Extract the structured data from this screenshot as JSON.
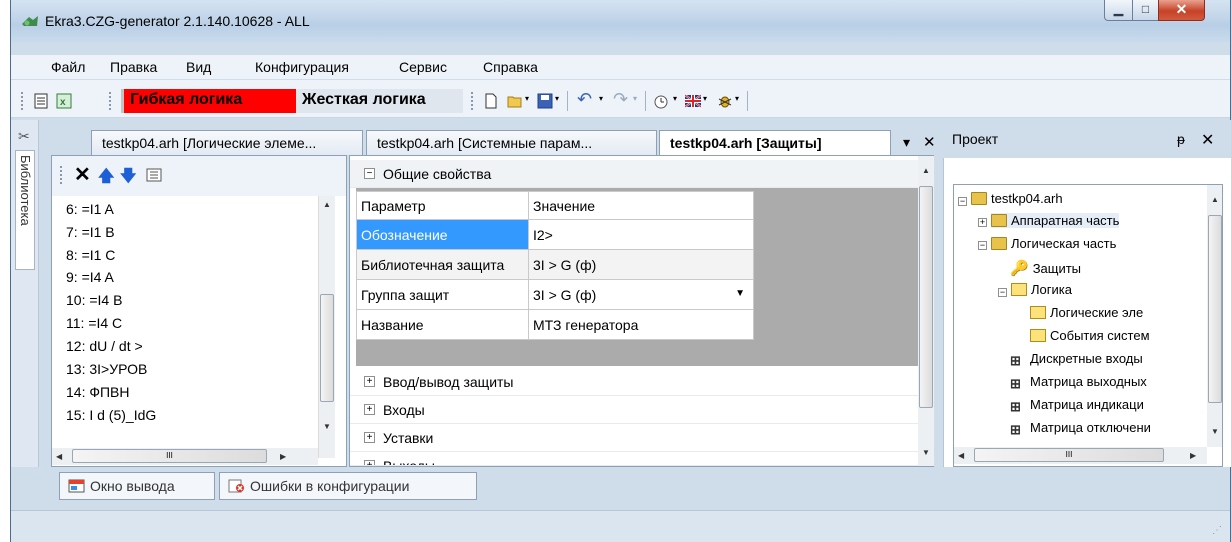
{
  "window": {
    "title": "Ekra3.CZG-generator 2.1.140.10628 - ALL",
    "minimize_glyph": "▁",
    "maximize_glyph": "□",
    "close_glyph": "✕"
  },
  "menu": [
    "Файл",
    "Правка",
    "Вид",
    "Конфигурация",
    "Сервис",
    "Справка"
  ],
  "toolbar": {
    "flex_logic_label": "Гибкая логика",
    "flex_logic_color": "#ff0000",
    "hard_logic_label": "Жесткая логика"
  },
  "side_strip": {
    "library_label": "Библиотека"
  },
  "doc_tabs": [
    {
      "label": "testkp04.arh [Логические элеме...",
      "active": false
    },
    {
      "label": "testkp04.arh [Системные парам...",
      "active": false
    },
    {
      "label": "testkp04.arh [Защиты]",
      "active": true
    }
  ],
  "doc_tabs_menu_glyph": "▾",
  "doc_tabs_close_glyph": "✕",
  "list_panel": {
    "items": [
      "6: =I1 A",
      "7: =I1 B",
      "8: =I1 C",
      "9: =I4 A",
      "10: =I4 B",
      "11: =I4 C",
      "12: dU / dt >",
      "13: 3I>УРОВ",
      "14: ФПВН",
      "15: I d (5)_IdG"
    ],
    "hscroll_mark": "III"
  },
  "properties": {
    "general_group": "Общие свойства",
    "header_param": "Параметр",
    "header_value": "Значение",
    "rows": [
      {
        "param": "Обозначение",
        "value": "I2>",
        "selected": true
      },
      {
        "param": "Библиотечная защита",
        "value": "3I > G (ф)",
        "selected": false
      },
      {
        "param": "Группа защит",
        "value": "3I > G (ф)",
        "selected": false,
        "dropdown": true
      },
      {
        "param": "Название",
        "value": "МТЗ генератора",
        "selected": false
      }
    ],
    "collapsed_groups": [
      "Ввод/вывод защиты",
      "Входы",
      "Уставки",
      "Выходы"
    ],
    "expanded_sign": "⊟",
    "collapsed_sign": "⊞"
  },
  "project": {
    "title": "Проект",
    "pin_glyph": "ᵽ",
    "close_glyph": "✕",
    "tree": {
      "root": "testkp04.arh",
      "hardware": "Аппаратная часть",
      "logic_part": "Логическая часть",
      "protections": "Защиты",
      "logic": "Логика",
      "logic_elements": "Логические эле",
      "system_events": "События систем",
      "discrete_inputs": "Дискретные входы",
      "output_matrix": "Матрица выходных",
      "indication_matrix": "Матрица индикаци",
      "trip_matrix": "Матрица отключени"
    },
    "hscroll_mark": "III"
  },
  "bottom_tabs": [
    "Окно вывода",
    "Ошибки в конфигурации"
  ]
}
